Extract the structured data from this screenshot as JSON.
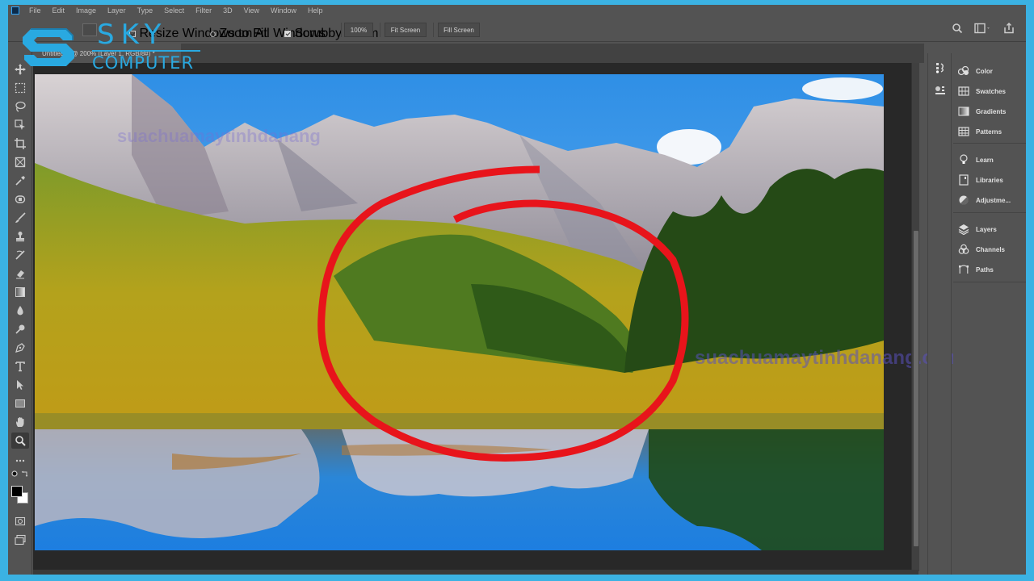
{
  "menubar": {
    "items": [
      "File",
      "Edit",
      "Image",
      "Layer",
      "Type",
      "Select",
      "Filter",
      "3D",
      "View",
      "Window",
      "Help"
    ]
  },
  "options_bar": {
    "resize_windows": "Resize Windows to Fit",
    "zoom_all_windows": "Zoom All Windows",
    "scrubby_zoom": "Scrubby Zoom",
    "scrubby_zoom_checked": true,
    "zoom_level": "100%",
    "fit_screen": "Fit Screen",
    "fill_screen": "Fill Screen"
  },
  "document_tab": {
    "title": "Untitled-1 @ 200% (Layer 1, RGB/8#) *"
  },
  "toolbar": {
    "tools": [
      "move",
      "marquee",
      "lasso",
      "object-selection",
      "crop",
      "frame",
      "eyedropper",
      "healing-brush",
      "brush",
      "clone-stamp",
      "history-brush",
      "eraser",
      "gradient",
      "blur",
      "dodge",
      "pen",
      "type",
      "path-selection",
      "rectangle",
      "hand",
      "zoom",
      "more"
    ],
    "active_tool": "zoom",
    "foreground_color": "#000000",
    "background_color": "#ffffff"
  },
  "right_panel": {
    "groups": [
      [
        {
          "icon": "color-icon",
          "label": "Color"
        },
        {
          "icon": "swatches-icon",
          "label": "Swatches"
        },
        {
          "icon": "gradients-icon",
          "label": "Gradients"
        },
        {
          "icon": "patterns-icon",
          "label": "Patterns"
        }
      ],
      [
        {
          "icon": "learn-icon",
          "label": "Learn"
        },
        {
          "icon": "libraries-icon",
          "label": "Libraries"
        },
        {
          "icon": "adjustments-icon",
          "label": "Adjustme..."
        }
      ],
      [
        {
          "icon": "layers-icon",
          "label": "Layers"
        },
        {
          "icon": "channels-icon",
          "label": "Channels"
        },
        {
          "icon": "paths-icon",
          "label": "Paths"
        }
      ]
    ]
  },
  "branding": {
    "logo_top": "SKY",
    "logo_bottom": "COMPUTER",
    "watermark": "suachuamaytinhdanang.com",
    "watermark_faint": "suachuamaytinhdanang"
  },
  "colors": {
    "frame_border": "#3bb2e3",
    "ui_background": "#535353",
    "canvas_background": "#282828",
    "highlight_circle": "#e8141b",
    "logo": "#29a9e1"
  },
  "scroll": {
    "vertical_thumb_start": 0.33,
    "vertical_thumb_end": 0.95
  }
}
